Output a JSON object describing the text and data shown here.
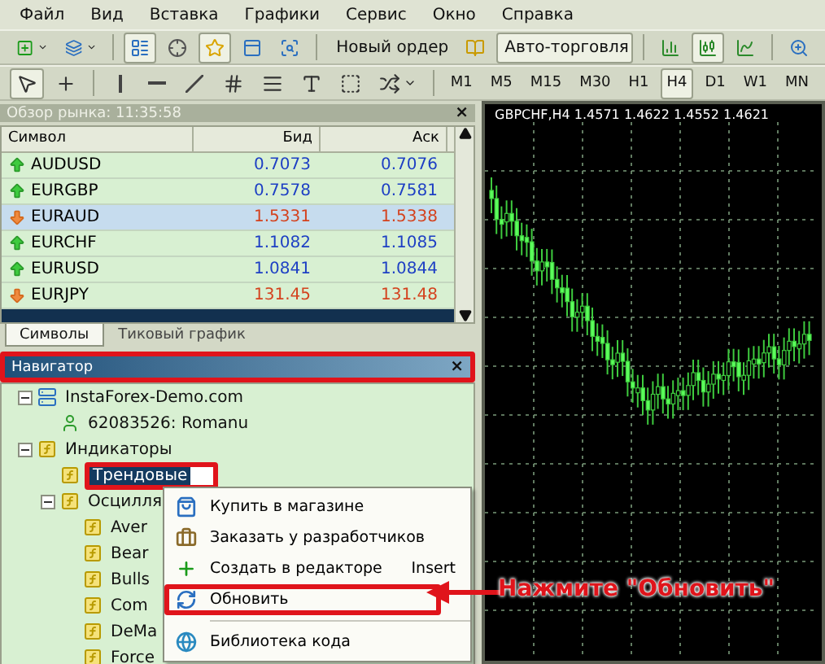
{
  "menu": [
    "Файл",
    "Вид",
    "Вставка",
    "Графики",
    "Сервис",
    "Окно",
    "Справка"
  ],
  "toolbar_main": [
    {
      "kind": "dropdown",
      "pressed": false
    },
    {
      "kind": "dropdown",
      "pressed": false
    },
    {
      "kind": "separator"
    },
    {
      "kind": "icon",
      "pressed": true
    },
    {
      "kind": "icon",
      "pressed": false
    },
    {
      "kind": "icon",
      "pressed": true
    },
    {
      "kind": "icon",
      "pressed": false
    },
    {
      "kind": "icon",
      "pressed": false
    },
    {
      "kind": "separator"
    },
    {
      "kind": "labeled",
      "label": "Новый ордер",
      "pressed": false
    },
    {
      "kind": "icon",
      "pressed": false
    },
    {
      "kind": "labeled",
      "label": "Авто-торговля",
      "pressed": true
    },
    {
      "kind": "separator"
    },
    {
      "kind": "icon",
      "pressed": false
    },
    {
      "kind": "icon",
      "pressed": true
    },
    {
      "kind": "icon",
      "pressed": false
    },
    {
      "kind": "separator"
    },
    {
      "kind": "icon",
      "pressed": false
    }
  ],
  "toolbar_tools": [
    {
      "kind": "icon",
      "pressed": true
    },
    {
      "kind": "icon",
      "pressed": false
    },
    {
      "kind": "separator"
    },
    {
      "kind": "icon",
      "pressed": false
    },
    {
      "kind": "icon",
      "pressed": false
    },
    {
      "kind": "icon",
      "pressed": false
    },
    {
      "kind": "icon",
      "pressed": false
    },
    {
      "kind": "icon",
      "pressed": false
    },
    {
      "kind": "icon",
      "pressed": false
    },
    {
      "kind": "icon",
      "pressed": false
    },
    {
      "kind": "dropdown",
      "pressed": false
    },
    {
      "kind": "separator"
    }
  ],
  "timeframes": [
    {
      "label": "M1",
      "selected": false
    },
    {
      "label": "M5",
      "selected": false
    },
    {
      "label": "M15",
      "selected": false
    },
    {
      "label": "M30",
      "selected": false
    },
    {
      "label": "H1",
      "selected": false
    },
    {
      "label": "H4",
      "selected": true
    },
    {
      "label": "D1",
      "selected": false
    },
    {
      "label": "W1",
      "selected": false
    },
    {
      "label": "MN",
      "selected": false
    }
  ],
  "market_watch": {
    "title": "Обзор рынка: 11:35:58",
    "close": "×",
    "columns": [
      "Символ",
      "Бид",
      "Аск"
    ],
    "rows": [
      {
        "symbol": "AUDUSD",
        "bid": "0.7073",
        "ask": "0.7076",
        "kind": "up",
        "selected": false
      },
      {
        "symbol": "EURGBP",
        "bid": "0.7578",
        "ask": "0.7581",
        "kind": "up",
        "selected": false
      },
      {
        "symbol": "EURAUD",
        "bid": "1.5331",
        "ask": "1.5338",
        "kind": "down",
        "selected": true
      },
      {
        "symbol": "EURCHF",
        "bid": "1.1082",
        "ask": "1.1085",
        "kind": "up",
        "selected": false
      },
      {
        "symbol": "EURUSD",
        "bid": "1.0841",
        "ask": "1.0844",
        "kind": "up",
        "selected": false
      },
      {
        "symbol": "EURJPY",
        "bid": "131.45",
        "ask": "131.48",
        "kind": "down",
        "selected": false
      }
    ],
    "tabs": [
      {
        "label": "Символы",
        "selected": true
      },
      {
        "label": "Тиковый график",
        "selected": false
      }
    ]
  },
  "navigator": {
    "title": "Навигатор",
    "close": "×",
    "highlighted": true,
    "tree": [
      {
        "label": "InstaForex-Demo.com",
        "kind": "server",
        "selected": false,
        "expanded": true,
        "children": [
          {
            "label": "62083526: Romanu",
            "kind": "account",
            "selected": false
          }
        ]
      },
      {
        "label": "Индикаторы",
        "kind": "indicator",
        "selected": false,
        "expanded": true,
        "children": [
          {
            "label": "Трендовые",
            "kind": "indicator",
            "selected": true,
            "highlighted": true
          },
          {
            "label": "Осцилля",
            "kind": "indicator",
            "selected": false,
            "expanded": true,
            "children": [
              {
                "label": "Aver",
                "kind": "indicator",
                "selected": false
              },
              {
                "label": "Bear",
                "kind": "indicator",
                "selected": false
              },
              {
                "label": "Bulls",
                "kind": "indicator",
                "selected": false
              },
              {
                "label": "Com",
                "kind": "indicator",
                "selected": false
              },
              {
                "label": "DeMa",
                "kind": "indicator",
                "selected": false
              },
              {
                "label": "Force",
                "kind": "indicator",
                "selected": false
              }
            ]
          }
        ]
      }
    ]
  },
  "context_menu": [
    {
      "label": "Купить в магазине",
      "highlighted": false
    },
    {
      "label": "Заказать у разработчиков",
      "highlighted": false
    },
    {
      "label": "Создать в редакторе",
      "shortcut": "Insert",
      "highlighted": false
    },
    {
      "label": "Обновить",
      "highlighted": true
    },
    {
      "label": "Библиотека кода",
      "separator_before": true,
      "highlighted": false
    }
  ],
  "chart": {
    "title": "GBPCHF,H4  1.4571 1.4622 1.4552 1.4621"
  },
  "callout": "Нажмите \"Обновить\""
}
